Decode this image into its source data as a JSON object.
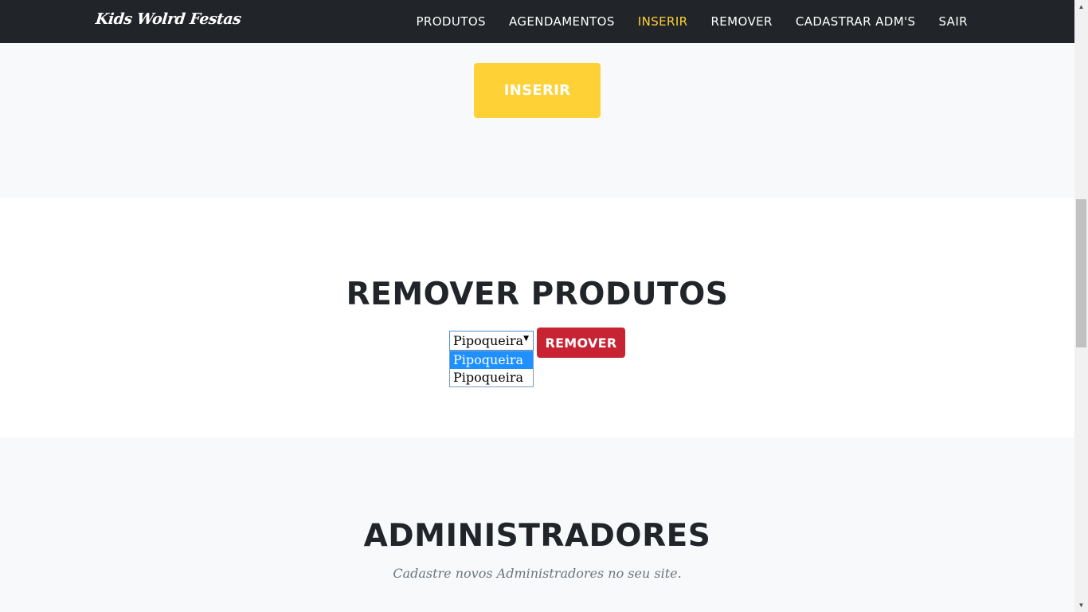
{
  "navbar": {
    "brand": "Kids Wolrd Festas",
    "items": [
      {
        "label": "PRODUTOS",
        "active": false
      },
      {
        "label": "AGENDAMENTOS",
        "active": false
      },
      {
        "label": "INSERIR",
        "active": true
      },
      {
        "label": "REMOVER",
        "active": false
      },
      {
        "label": "CADASTRAR ADM'S",
        "active": false
      },
      {
        "label": "SAIR",
        "active": false
      }
    ]
  },
  "insert_section": {
    "button_label": "INSERIR"
  },
  "remove_section": {
    "title": "REMOVER PRODUTOS",
    "select_value": "Pipoqueira",
    "options": [
      "Pipoqueira",
      "Pipoqueira"
    ],
    "highlighted_option_index": 0,
    "button_label": "REMOVER"
  },
  "admin_section": {
    "title": "ADMINISTRADORES",
    "subtitle": "Cadastre novos Administradores no seu site."
  },
  "colors": {
    "navbar_bg": "#212529",
    "accent_yellow": "#fed136",
    "danger_red": "#c82333",
    "highlight_blue": "#1e90ff"
  },
  "icons": {
    "select_arrow": "caret-down-icon",
    "scroll_up": "scroll-up-arrow-icon",
    "scroll_down": "scroll-down-arrow-icon"
  }
}
